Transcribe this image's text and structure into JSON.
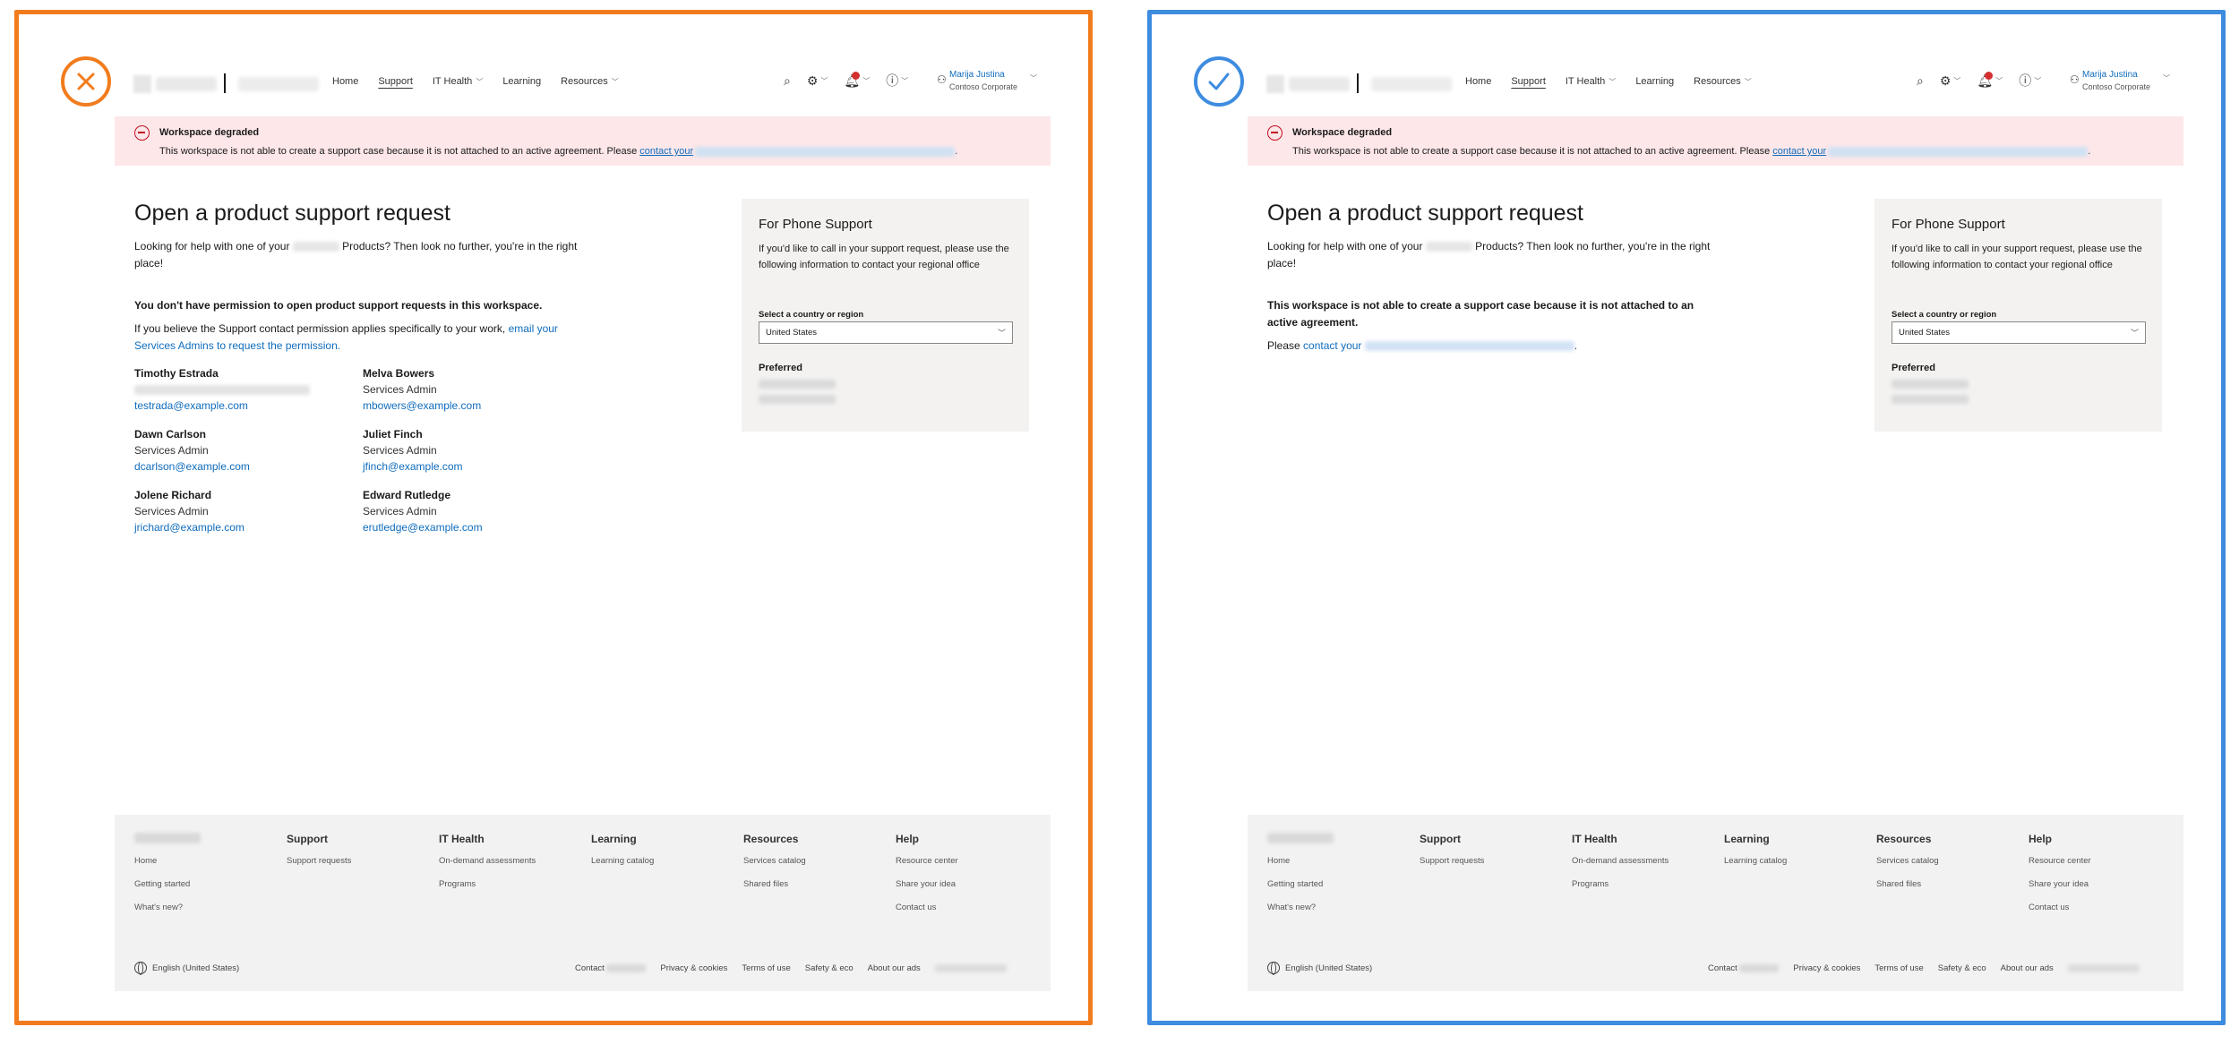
{
  "header": {
    "nav": [
      {
        "label": "Home",
        "dropdown": false,
        "active": false
      },
      {
        "label": "Support",
        "dropdown": false,
        "active": true
      },
      {
        "label": "IT Health",
        "dropdown": true,
        "active": false
      },
      {
        "label": "Learning",
        "dropdown": false,
        "active": false
      },
      {
        "label": "Resources",
        "dropdown": true,
        "active": false
      }
    ],
    "user_name": "Marija Justina",
    "user_org": "Contoso Corporate",
    "icons": [
      "search-icon",
      "settings-icon",
      "notifications-icon",
      "help-icon",
      "person-icon"
    ]
  },
  "banner": {
    "title": "Workspace degraded",
    "text": "This workspace is not able to create a support case because it is not attached to an active agreement. Please",
    "link": "contact your"
  },
  "main": {
    "title": "Open a product support request",
    "intro_a": "Looking for help with one of your",
    "intro_b": "Products? Then look no further, you're in the right place!"
  },
  "bad": {
    "no_permission": "You don't have permission to open product support requests in this workspace.",
    "para": "If you believe the Support contact permission applies specifically to your work,",
    "para_link": "email your Services Admins to request the permission.",
    "admins": [
      {
        "name": "Timothy Estrada",
        "role": "",
        "email": "testrada@example.com"
      },
      {
        "name": "Melva Bowers",
        "role": "Services Admin",
        "email": "mbowers@example.com"
      },
      {
        "name": "Dawn Carlson",
        "role": "Services Admin",
        "email": "dcarlson@example.com"
      },
      {
        "name": "Juliet Finch",
        "role": "Services Admin",
        "email": "jfinch@example.com"
      },
      {
        "name": "Jolene Richard",
        "role": "Services Admin",
        "email": "jrichard@example.com"
      },
      {
        "name": "Edward Rutledge",
        "role": "Services Admin",
        "email": "erutledge@example.com"
      }
    ]
  },
  "good": {
    "bold": "This workspace is not able to create a support case because it is not attached to an active agreement.",
    "please": "Please",
    "link": "contact your"
  },
  "phone": {
    "title": "For Phone Support",
    "desc": "If you'd like to call in your support request, please use the following information to contact your regional office",
    "label": "Select a country or region",
    "selected": "United States",
    "preferred": "Preferred"
  },
  "footer": {
    "columns": [
      {
        "heading": "",
        "items": [
          "Home",
          "Getting started",
          "What's new?"
        ]
      },
      {
        "heading": "Support",
        "items": [
          "Support requests"
        ]
      },
      {
        "heading": "IT Health",
        "items": [
          "On-demand assessments",
          "Programs"
        ]
      },
      {
        "heading": "Learning",
        "items": [
          "Learning catalog"
        ]
      },
      {
        "heading": "Resources",
        "items": [
          "Services catalog",
          "Shared files"
        ]
      },
      {
        "heading": "Help",
        "items": [
          "Resource center",
          "Share your idea",
          "Contact us"
        ]
      }
    ],
    "language": "English (United States)",
    "links": [
      "Contact",
      "Privacy & cookies",
      "Terms of use",
      "Safety & eco",
      "About our ads"
    ]
  },
  "colors": {
    "bad_accent": "#f27c1d",
    "good_accent": "#3e8ce0",
    "link": "#0f6cbd",
    "banner_bg": "#fde7e9",
    "error": "#c50f1f"
  }
}
